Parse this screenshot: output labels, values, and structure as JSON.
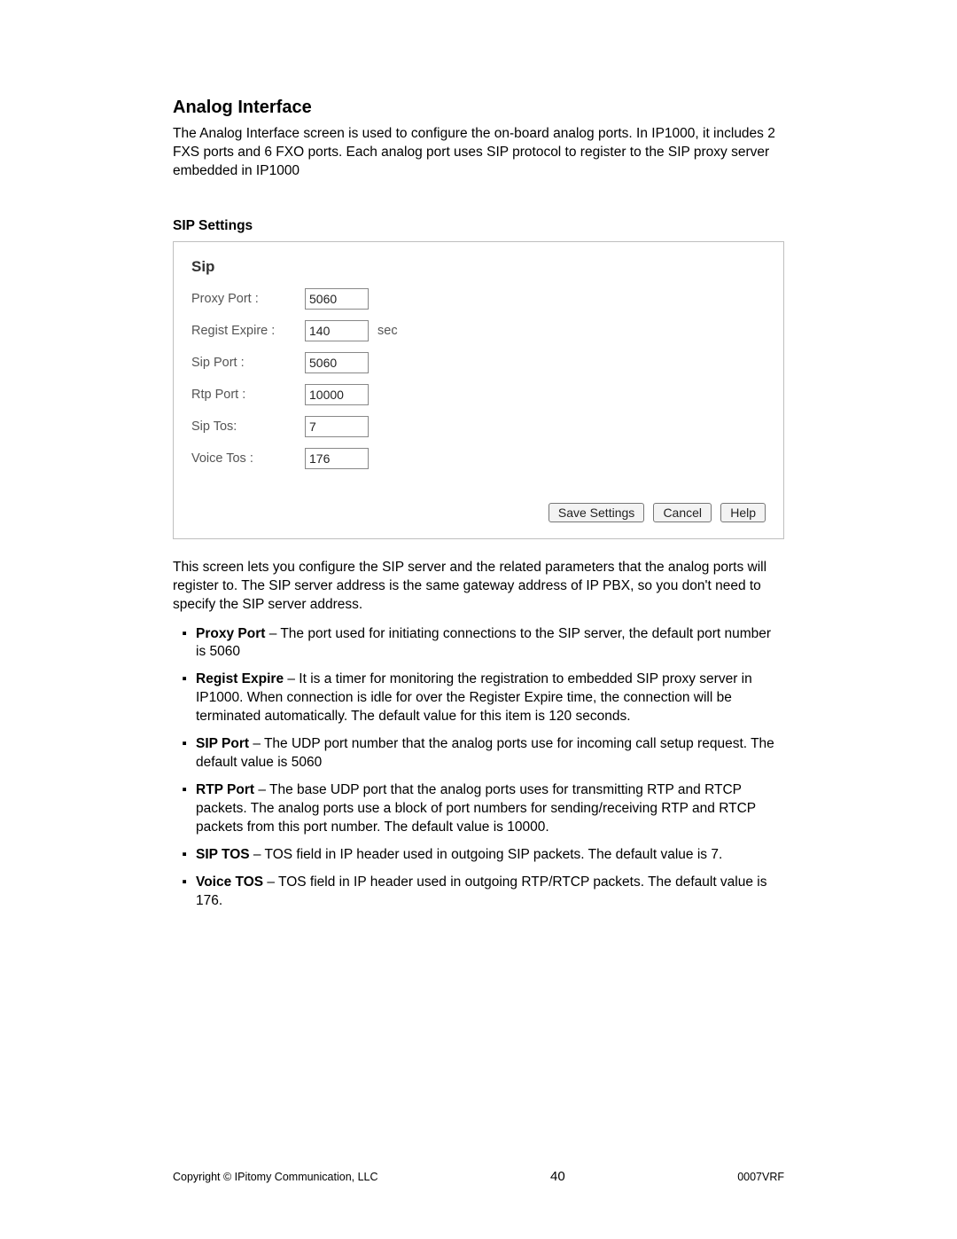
{
  "title": "Analog Interface",
  "intro": "The Analog Interface screen is used to configure the on-board analog ports. In IP1000, it includes 2 FXS ports and 6 FXO ports. Each analog port uses SIP protocol to register to the SIP proxy server embedded in IP1000",
  "subhead": "SIP Settings",
  "panel": {
    "title": "Sip",
    "rows": [
      {
        "label": "Proxy Port :",
        "value": "5060",
        "unit": ""
      },
      {
        "label": "Regist Expire :",
        "value": "140",
        "unit": "sec"
      },
      {
        "label": "Sip Port :",
        "value": "5060",
        "unit": ""
      },
      {
        "label": "Rtp Port :",
        "value": "10000",
        "unit": ""
      },
      {
        "label": "Sip Tos:",
        "value": "7",
        "unit": ""
      },
      {
        "label": "Voice Tos :",
        "value": "176",
        "unit": ""
      }
    ],
    "buttons": {
      "save": "Save  Settings",
      "cancel": "Cancel",
      "help": "Help"
    }
  },
  "desc": "This screen lets you configure the SIP server and the related parameters that the analog ports will register to. The SIP server address is the same gateway address of IP PBX, so you don't need to specify the SIP server address.",
  "bullets": [
    {
      "term": "Proxy Port",
      "text": " – The port used for initiating connections to the SIP server, the default port number is 5060"
    },
    {
      "term": "Regist Expire",
      "text": " – It is a timer for monitoring the registration to embedded SIP proxy server in IP1000. When connection is idle for over the Register Expire time, the connection will be terminated automatically. The default value for this item is 120 seconds."
    },
    {
      "term": "SIP Port",
      "text": " – The UDP port number that the analog ports use for incoming call setup request. The default value is 5060"
    },
    {
      "term": "RTP Port",
      "text": " – The base UDP port that the analog ports uses for transmitting RTP and RTCP packets. The analog ports use a block of port numbers for sending/receiving RTP and RTCP packets from this port number. The default value is 10000."
    },
    {
      "term": "SIP TOS",
      "text": " – TOS field in IP header used in outgoing SIP packets. The default value is 7."
    },
    {
      "term": "Voice TOS",
      "text": " – TOS field in IP header used in outgoing RTP/RTCP packets. The default value is 176."
    }
  ],
  "footer": {
    "left": "Copyright © IPitomy Communication, LLC",
    "page": "40",
    "right": "0007VRF"
  }
}
